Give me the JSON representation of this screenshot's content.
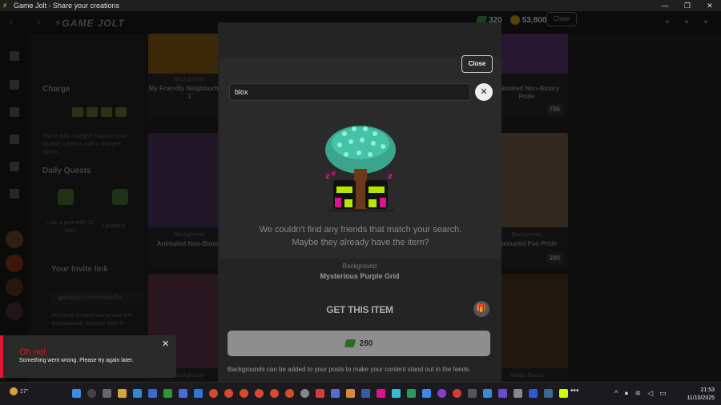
{
  "window": {
    "title": "Game Jolt - Share your creations",
    "controls": [
      "—",
      "❐",
      "✕"
    ]
  },
  "topbar": {
    "nav": "‹ ›",
    "logo": "⚡GAME JOLT",
    "coins_gems": "320",
    "coins_gold": "53,800",
    "close_label": "Close"
  },
  "sidebar": {
    "charge_title": "Charge",
    "charge_text": "You're fully charged! Support your favorite creators with a charged sticker.",
    "quests_title": "Daily Quests",
    "quest1": "Like a post with 10 likes",
    "quest2": "Upload a",
    "invite_title": "Your Invite link",
    "invite_url": "gamejolt.com/invite/Ba",
    "invite_text": "Accounts created using your link automatically become your fo"
  },
  "cards": [
    {
      "cat": "Background",
      "title": "My Friendly Neighborhood 1",
      "price": ""
    },
    {
      "cat": "",
      "title": "",
      "price": ""
    },
    {
      "cat": "Background",
      "title": "Animated Non-Binary Pride",
      "price": "780"
    },
    {
      "cat": "Background",
      "title": "Animated Non-Binary",
      "price": ""
    },
    {
      "cat": "Background",
      "title": "Animated Pan Pride",
      "price": "280"
    },
    {
      "cat": "Background",
      "title": "",
      "price": ""
    },
    {
      "cat": "Avatar Frame",
      "title": "",
      "price": ""
    }
  ],
  "detail": {
    "category": "Background",
    "name": "Mysterious Purple Grid",
    "get_label": "GET THIS ITEM",
    "price": "280",
    "description": "Backgrounds can be added to your posts to make your content stand out in the feeds."
  },
  "modal": {
    "close_label": "Close",
    "search_value": "blox",
    "empty_line1": "We couldn't find any friends that match your search.",
    "empty_line2": "Maybe they already have the item?"
  },
  "toast": {
    "title": "Oh no!",
    "message": "Something went wrong. Please try again later."
  },
  "taskbar": {
    "temperature": "17°",
    "time": "21:53",
    "date": "11/10/2025"
  }
}
